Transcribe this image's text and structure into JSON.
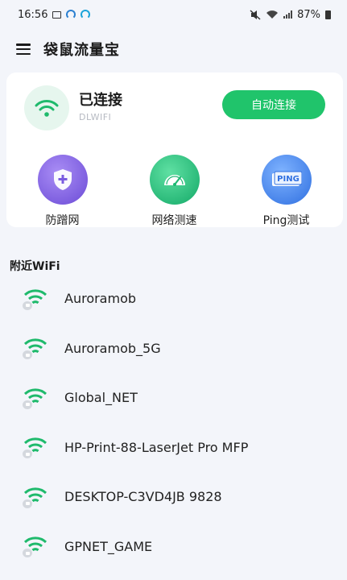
{
  "status_bar": {
    "time": "16:56",
    "battery": "87%"
  },
  "header": {
    "title": "袋鼠流量宝"
  },
  "connection": {
    "status": "已连接",
    "ssid": "DLWIFI",
    "auto_button": "自动连接"
  },
  "tools": [
    {
      "label": "防蹭网",
      "icon": "shield-plus-icon",
      "color": "#7a5be0"
    },
    {
      "label": "网络测速",
      "icon": "speedometer-icon",
      "color": "#1fb873"
    },
    {
      "label": "Ping测试",
      "icon": "ping-icon",
      "color": "#3b7ff0"
    }
  ],
  "nearby": {
    "title": "附近WiFi",
    "networks": [
      {
        "name": "Auroramob"
      },
      {
        "name": "Auroramob_5G"
      },
      {
        "name": "Global_NET"
      },
      {
        "name": "HP-Print-88-LaserJet Pro MFP"
      },
      {
        "name": "DESKTOP-C3VD4JB 9828"
      },
      {
        "name": "GPNET_GAME"
      }
    ]
  },
  "colors": {
    "accent": "#20c46b",
    "background": "#f3f5fa"
  }
}
